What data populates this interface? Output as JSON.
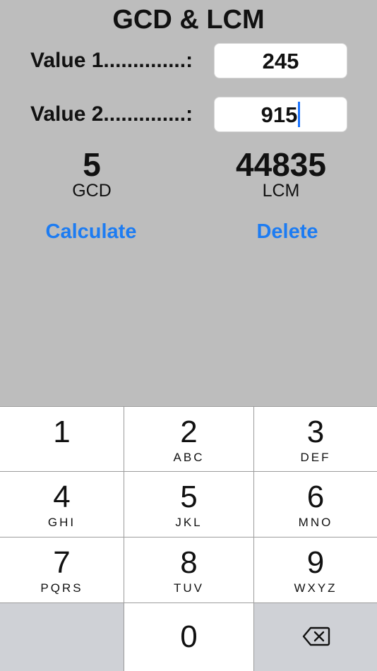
{
  "app": {
    "title": "GCD & LCM",
    "value1_label": "Value 1..............:",
    "value1": "245",
    "value2_label": "Value 2..............:",
    "value2": "915",
    "gcd_value": "5",
    "gcd_label": "GCD",
    "lcm_value": "44835",
    "lcm_label": "LCM",
    "calculate_label": "Calculate",
    "delete_label": "Delete",
    "accent_color": "#1d7cf2"
  },
  "keypad": {
    "keys": [
      {
        "num": "1",
        "letters": ""
      },
      {
        "num": "2",
        "letters": "ABC"
      },
      {
        "num": "3",
        "letters": "DEF"
      },
      {
        "num": "4",
        "letters": "GHI"
      },
      {
        "num": "5",
        "letters": "JKL"
      },
      {
        "num": "6",
        "letters": "MNO"
      },
      {
        "num": "7",
        "letters": "PQRS"
      },
      {
        "num": "8",
        "letters": "TUV"
      },
      {
        "num": "9",
        "letters": "WXYZ"
      },
      {
        "num": "0",
        "letters": ""
      }
    ],
    "backspace_icon": "backspace-icon"
  }
}
